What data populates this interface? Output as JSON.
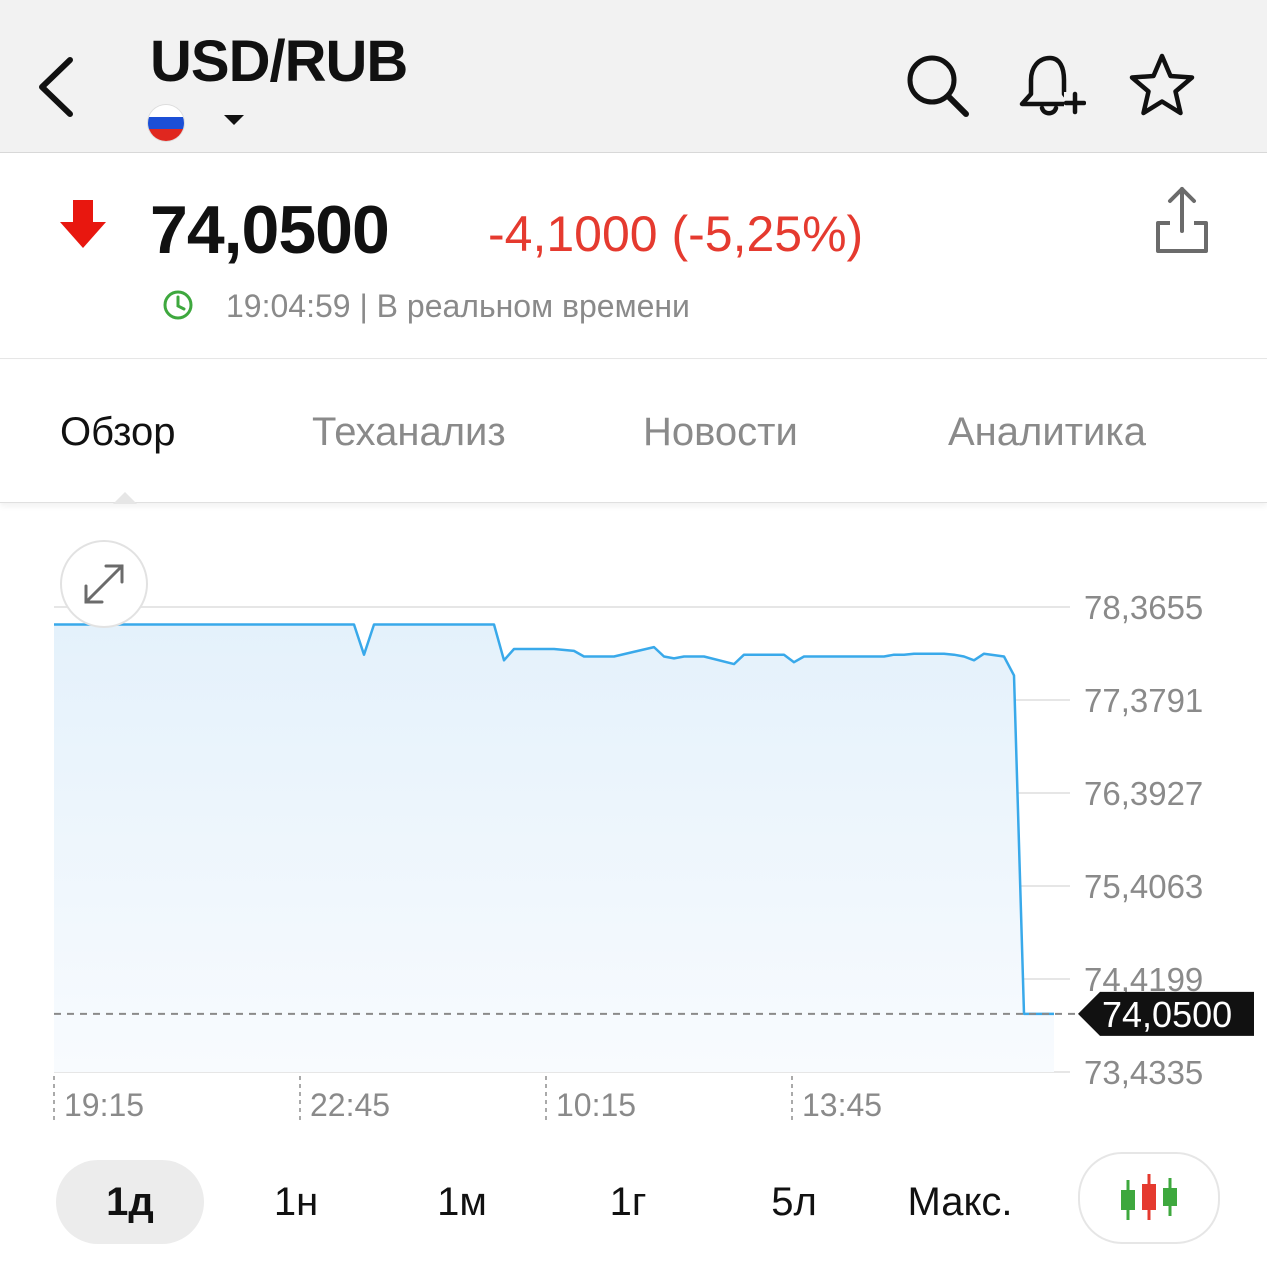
{
  "header": {
    "title": "USD/RUB",
    "icons": [
      "back-chevron-icon",
      "russia-flag-icon",
      "caret-down-icon",
      "search-icon",
      "bell-plus-icon",
      "star-icon"
    ]
  },
  "quote": {
    "price": "74,0500",
    "change": "-4,1000 (-5,25%)",
    "time_status": "19:04:59 | В реальном времени",
    "change_color": "#e53a2f",
    "direction": "down"
  },
  "tabs": [
    {
      "label": "Обзор",
      "active": true
    },
    {
      "label": "Теханализ",
      "active": false
    },
    {
      "label": "Новости",
      "active": false
    },
    {
      "label": "Аналитика",
      "active": false
    }
  ],
  "periods": [
    {
      "label": "1д",
      "active": true
    },
    {
      "label": "1н",
      "active": false
    },
    {
      "label": "1м",
      "active": false
    },
    {
      "label": "1г",
      "active": false
    },
    {
      "label": "5л",
      "active": false
    },
    {
      "label": "Макс.",
      "active": false
    }
  ],
  "chart_data": {
    "type": "area",
    "y_ticks": [
      "78,3655",
      "77,3791",
      "76,3927",
      "75,4063",
      "74,4199",
      "73,4335"
    ],
    "ylim": [
      73.4335,
      78.3655
    ],
    "x_ticks": [
      "19:15",
      "22:45",
      "10:15",
      "13:45"
    ],
    "current_value_label": "74,0500",
    "current_value": 74.05,
    "line_color": "#39a9ea",
    "x": [
      0,
      0.3,
      0.31,
      0.32,
      0.44,
      0.45,
      0.46,
      0.5,
      0.52,
      0.53,
      0.56,
      0.6,
      0.61,
      0.62,
      0.63,
      0.65,
      0.68,
      0.69,
      0.7,
      0.71,
      0.72,
      0.73,
      0.74,
      0.75,
      0.76,
      0.77,
      0.78,
      0.79,
      0.8,
      0.81,
      0.83,
      0.84,
      0.85,
      0.86,
      0.88,
      0.89,
      0.9,
      0.91,
      0.92,
      0.93,
      0.95,
      0.96,
      0.97,
      1.0
    ],
    "values": [
      78.18,
      78.18,
      77.86,
      78.18,
      78.18,
      77.8,
      77.92,
      77.92,
      77.9,
      77.84,
      77.84,
      77.94,
      77.84,
      77.82,
      77.84,
      77.84,
      77.76,
      77.86,
      77.86,
      77.86,
      77.86,
      77.86,
      77.78,
      77.84,
      77.84,
      77.84,
      77.84,
      77.84,
      77.84,
      77.84,
      77.84,
      77.86,
      77.86,
      77.87,
      77.87,
      77.87,
      77.86,
      77.84,
      77.8,
      77.87,
      77.84,
      77.64,
      74.05,
      74.05
    ]
  }
}
